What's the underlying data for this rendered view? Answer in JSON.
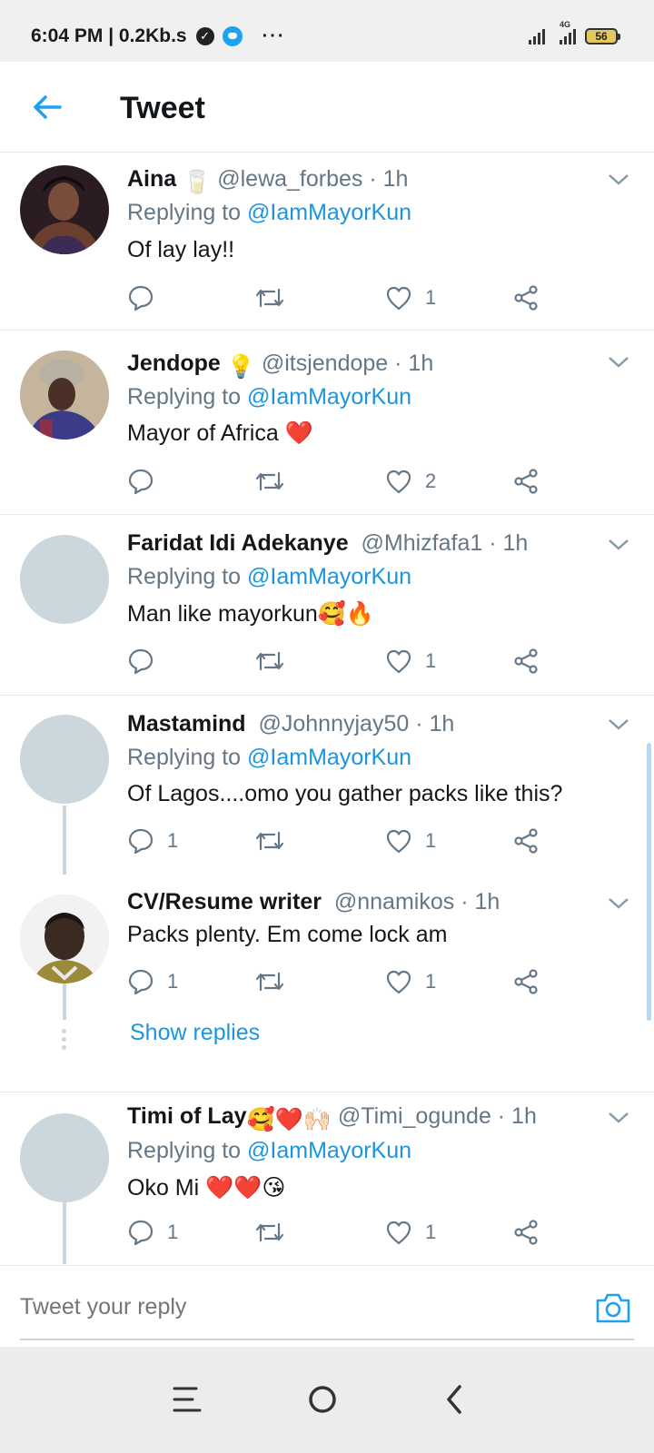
{
  "status_bar": {
    "time_speed": "6:04 PM | 0.2Kb.s",
    "more": "···",
    "network": "4G",
    "battery": "56"
  },
  "header": {
    "title": "Tweet"
  },
  "tweets": [
    {
      "name": "Aina",
      "name_emoji": "🥛",
      "handle": "@lewa_forbes · 1h",
      "replying_prefix": "Replying to ",
      "replying_mention": "@IamMayorKun",
      "text": "Of lay lay!!",
      "replies": "",
      "likes": "1"
    },
    {
      "name": "Jendope",
      "name_emoji": "💡",
      "handle": "@itsjendope · 1h",
      "replying_prefix": "Replying to ",
      "replying_mention": "@IamMayorKun",
      "text": "Mayor of Africa ❤️",
      "replies": "",
      "likes": "2"
    },
    {
      "name": "Faridat Idi Adekanye",
      "name_emoji": "",
      "handle": "@Mhizfafa1 · 1h",
      "replying_prefix": "Replying to ",
      "replying_mention": "@IamMayorKun",
      "text": "Man like mayorkun🥰🔥",
      "replies": "",
      "likes": "1"
    },
    {
      "name": "Mastamind",
      "name_emoji": "",
      "handle": "@Johnnyjay50 · 1h",
      "replying_prefix": "Replying to ",
      "replying_mention": "@IamMayorKun",
      "text": "Of Lagos....omo you gather packs like this?",
      "replies": "1",
      "likes": "1"
    },
    {
      "name": "CV/Resume writer",
      "name_emoji": "",
      "handle": "@nnamikos · 1h",
      "text": "Packs plenty. Em come lock am",
      "replies": "1",
      "likes": "1",
      "show_replies": "Show replies"
    },
    {
      "name": "Timi of Lay",
      "name_emoji": "🥰❤️🙌🏻",
      "handle": "@Timi_ogunde · 1h",
      "replying_prefix": "Replying to ",
      "replying_mention": "@IamMayorKun",
      "text": "Oko Mi ❤️❤️😘",
      "replies": "1",
      "likes": "1"
    }
  ],
  "reply_bar": {
    "placeholder": "Tweet your reply"
  },
  "icons": {
    "back": "arrow-left-icon",
    "caret": "chevron-down-icon",
    "reply": "speech-bubble-icon",
    "retweet": "retweet-icon",
    "like": "heart-icon",
    "share": "share-icon",
    "camera": "camera-icon"
  },
  "colors": {
    "accent": "#1da1f2",
    "mention": "#1b95e0",
    "secondary_text": "#657786",
    "divider": "#e1e8ed",
    "avatar_placeholder": "#ccd6dd"
  }
}
